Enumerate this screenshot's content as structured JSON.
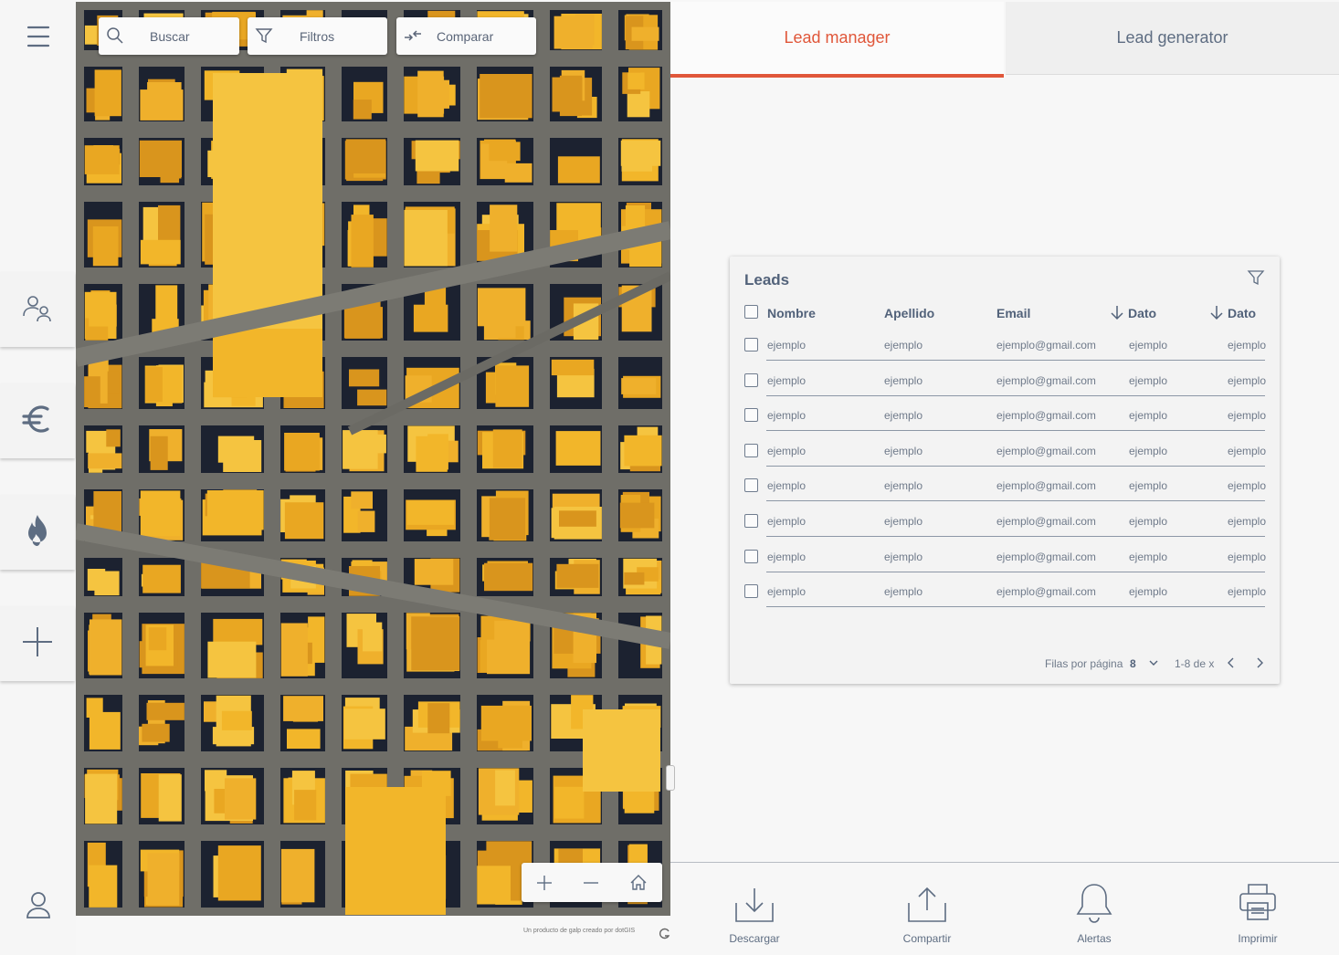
{
  "sidebar": {
    "items": [
      {
        "icon": "users-icon"
      },
      {
        "icon": "euro-icon"
      },
      {
        "icon": "flame-icon"
      },
      {
        "icon": "plus-icon"
      }
    ],
    "menu_icon": "hamburger-menu-icon",
    "user_icon": "user-icon"
  },
  "map": {
    "toolbar": {
      "search_label": "Buscar",
      "filters_label": "Filtros",
      "compare_label": "Comparar"
    },
    "credit": "Un producto de galp creado por dotGIS"
  },
  "tabs": [
    {
      "label": "Lead manager",
      "active": true
    },
    {
      "label": "Lead generator",
      "active": false
    }
  ],
  "leads": {
    "title": "Leads",
    "columns": [
      "Nombre",
      "Apellido",
      "Email",
      "Dato",
      "Dato"
    ],
    "rows": [
      [
        "ejemplo",
        "ejemplo",
        "ejemplo@gmail.com",
        "ejemplo",
        "ejemplo"
      ],
      [
        "ejemplo",
        "ejemplo",
        "ejemplo@gmail.com",
        "ejemplo",
        "ejemplo"
      ],
      [
        "ejemplo",
        "ejemplo",
        "ejemplo@gmail.com",
        "ejemplo",
        "ejemplo"
      ],
      [
        "ejemplo",
        "ejemplo",
        "ejemplo@gmail.com",
        "ejemplo",
        "ejemplo"
      ],
      [
        "ejemplo",
        "ejemplo",
        "ejemplo@gmail.com",
        "ejemplo",
        "ejemplo"
      ],
      [
        "ejemplo",
        "ejemplo",
        "ejemplo@gmail.com",
        "ejemplo",
        "ejemplo"
      ],
      [
        "ejemplo",
        "ejemplo",
        "ejemplo@gmail.com",
        "ejemplo",
        "ejemplo"
      ],
      [
        "ejemplo",
        "ejemplo",
        "ejemplo@gmail.com",
        "ejemplo",
        "ejemplo"
      ]
    ],
    "pagination": {
      "rows_per_page_label": "Filas por página",
      "rows_per_page_value": "8",
      "range": "1-8 de x"
    }
  },
  "actions": {
    "download": "Descargar",
    "share": "Compartir",
    "alerts": "Alertas",
    "print": "Imprimir"
  },
  "colors": {
    "accent": "#e0573a",
    "text": "#52627a",
    "roof": "#f2b62a",
    "shadow": "#1c2230"
  }
}
